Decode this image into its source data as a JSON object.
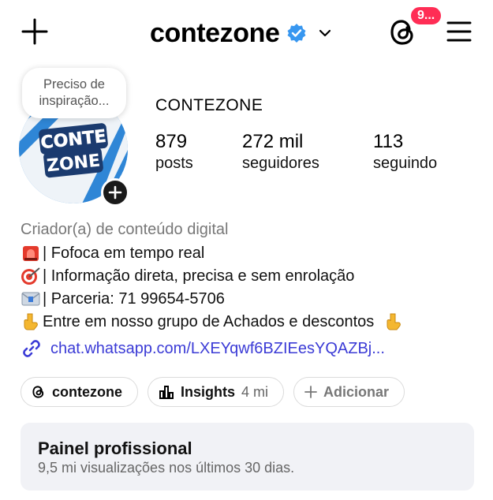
{
  "header": {
    "username": "contezone",
    "notification_badge": "9..."
  },
  "note": {
    "line1": "Preciso de",
    "line2": "inspiração..."
  },
  "profile": {
    "display_name": "CONTEZONE",
    "stats": [
      {
        "value": "879",
        "label": "posts"
      },
      {
        "value": "272 mil",
        "label": "seguidores"
      },
      {
        "value": "113",
        "label": "seguindo"
      }
    ]
  },
  "avatar": {
    "logo_line1": "CONTE",
    "logo_line2": "ZONE"
  },
  "bio": {
    "category": "Criador(a) de conteúdo digital",
    "lines": [
      {
        "icon": "siren-icon",
        "text": "| Fofoca em tempo real"
      },
      {
        "icon": "target-icon",
        "text": "| Informação direta, precisa e sem enrolação"
      },
      {
        "icon": "envelope-icon",
        "text": "| Parceria: 71 99654-5706"
      },
      {
        "icon": "pointing-down-icon",
        "text": "Entre em nosso grupo de Achados e descontos"
      }
    ],
    "link": "chat.whatsapp.com/LXEYqwf6BZIEesYQAZBj..."
  },
  "chips": {
    "threads_label": "contezone",
    "insights_label": "Insights",
    "insights_count": "4 mi",
    "add_label": "Adicionar"
  },
  "panel": {
    "title": "Painel profissional",
    "subtitle": "9,5 mi visualizações nos últimos 30 dias."
  },
  "colors": {
    "verified_blue": "#3897f0",
    "badge_red": "#ff2d55",
    "link_blue": "#3b3bd6",
    "panel_bg": "#f1f2f6"
  }
}
